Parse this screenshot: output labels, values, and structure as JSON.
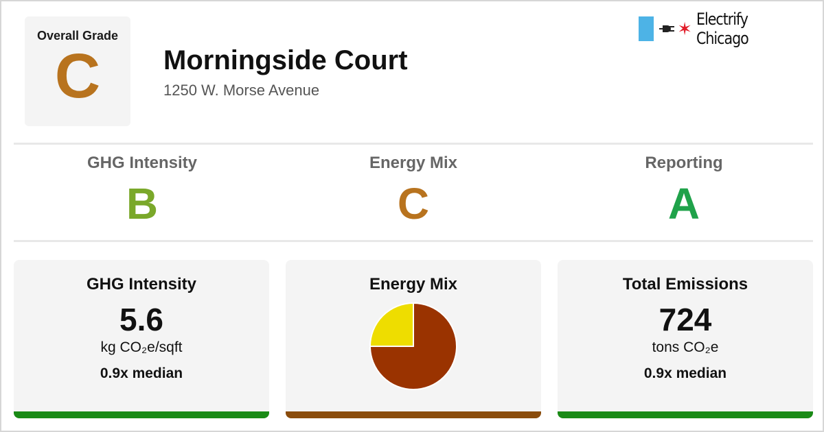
{
  "overall": {
    "label": "Overall Grade",
    "grade": "C",
    "color": "#b8731e"
  },
  "building": {
    "name": "Morningside Court",
    "address": "1250 W. Morse Avenue"
  },
  "brand": {
    "name": "Electrify Chicago",
    "star": "✶",
    "flag_color": "#4db3e6",
    "star_color": "#e11d2a"
  },
  "grades": [
    {
      "label": "GHG Intensity",
      "grade": "B",
      "color": "#7aa82a"
    },
    {
      "label": "Energy Mix",
      "grade": "C",
      "color": "#b8731e"
    },
    {
      "label": "Reporting",
      "grade": "A",
      "color": "#1fa24a"
    }
  ],
  "cards": {
    "ghg": {
      "title": "GHG Intensity",
      "value": "5.6",
      "unit": "kg CO₂e/sqft",
      "median": "0.9x median",
      "bar_color": "#1a8a16"
    },
    "mix": {
      "title": "Energy Mix",
      "bar_color": "#8a4c0c"
    },
    "emissions": {
      "title": "Total Emissions",
      "value": "724",
      "unit": "tons CO₂e",
      "median": "0.9x median",
      "bar_color": "#1a8a16"
    }
  },
  "chart_data": {
    "type": "pie",
    "slices": [
      {
        "value": 75,
        "color": "#9a3300"
      },
      {
        "value": 25,
        "color": "#eedd00"
      }
    ]
  }
}
